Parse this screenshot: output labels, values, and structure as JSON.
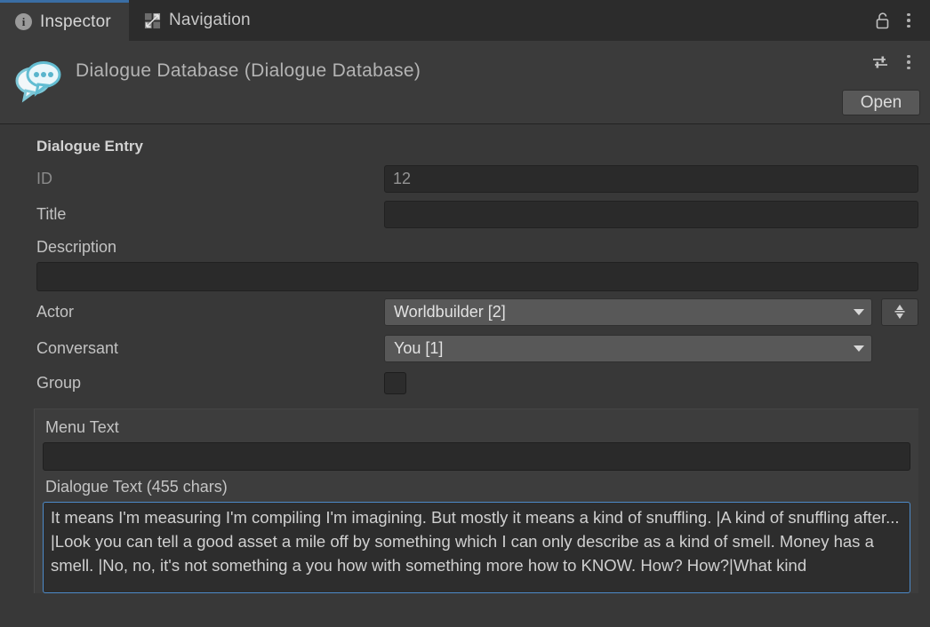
{
  "tabs": [
    {
      "label": "Inspector",
      "icon": "info-icon",
      "active": true
    },
    {
      "label": "Navigation",
      "icon": "move-arrows-icon",
      "active": false
    }
  ],
  "tabbar_actions": {
    "lock": "lock-icon",
    "menu": "kebab-menu-icon"
  },
  "object_header": {
    "icon": "dialogue-bubble-icon",
    "title": "Dialogue Database (Dialogue Database)",
    "preset_icon": "preset-sliders-icon",
    "menu_icon": "kebab-menu-icon",
    "open_label": "Open"
  },
  "inspector": {
    "section_title": "Dialogue Entry",
    "fields": {
      "id": {
        "label": "ID",
        "value": "12",
        "disabled": true
      },
      "title": {
        "label": "Title",
        "value": ""
      },
      "description": {
        "label": "Description",
        "value": ""
      },
      "actor": {
        "label": "Actor",
        "value": "Worldbuilder [2]"
      },
      "conversant": {
        "label": "Conversant",
        "value": "You [1]"
      },
      "group": {
        "label": "Group",
        "checked": false
      }
    },
    "swap_button": "swap-actors-icon",
    "menu_text": {
      "label": "Menu Text",
      "value": ""
    },
    "dialogue_text": {
      "label": "Dialogue Text (455 chars)",
      "value": "It means I'm measuring I'm compiling I'm imagining. But mostly it means a kind of snuffling. |A kind of snuffling after... |Look you can tell a good asset a mile off by something which I can only describe as a kind of smell. Money has a smell. |No, no, it's not something a you how with something more how to KNOW. How? How?|What kind"
    }
  },
  "colors": {
    "accent_tab": "#3a6ea5",
    "focus_border": "#4d8ac9",
    "panel_bg": "#383838",
    "header_bg": "#3b3b3b",
    "tabbar_bg": "#2c2c2c",
    "input_bg": "#2a2a2a",
    "popup_bg": "#585858"
  }
}
